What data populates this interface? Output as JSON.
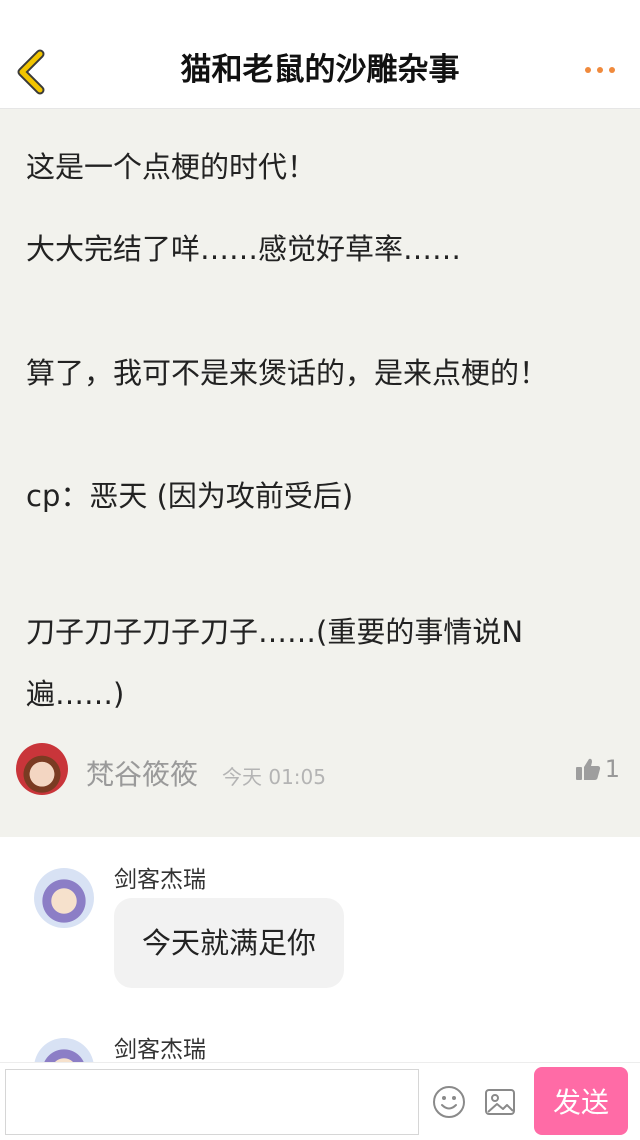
{
  "header": {
    "title": "猫和老鼠的沙雕杂事"
  },
  "post": {
    "lines": [
      "这是一个点梗的时代！",
      "大大完结了咩……感觉好草率……",
      "算了，我可不是来煲话的，是来点梗的！",
      "cp：恶天 (因为攻前受后)",
      "刀子刀子刀子刀子……(重要的事情说N遍……)"
    ],
    "author": "梵谷筱筱",
    "time": "今天 01:05",
    "likes": "1"
  },
  "comments": [
    {
      "name": "剑客杰瑞",
      "text": "今天就满足你"
    },
    {
      "name": "剑客杰瑞",
      "text": ""
    }
  ],
  "composer": {
    "input_value": "",
    "send_label": "发送"
  },
  "colors": {
    "accent": "#ff6ba6",
    "back_icon": "#f2c500",
    "more_icon": "#f08a3c",
    "post_bg": "#f2f2ed"
  }
}
